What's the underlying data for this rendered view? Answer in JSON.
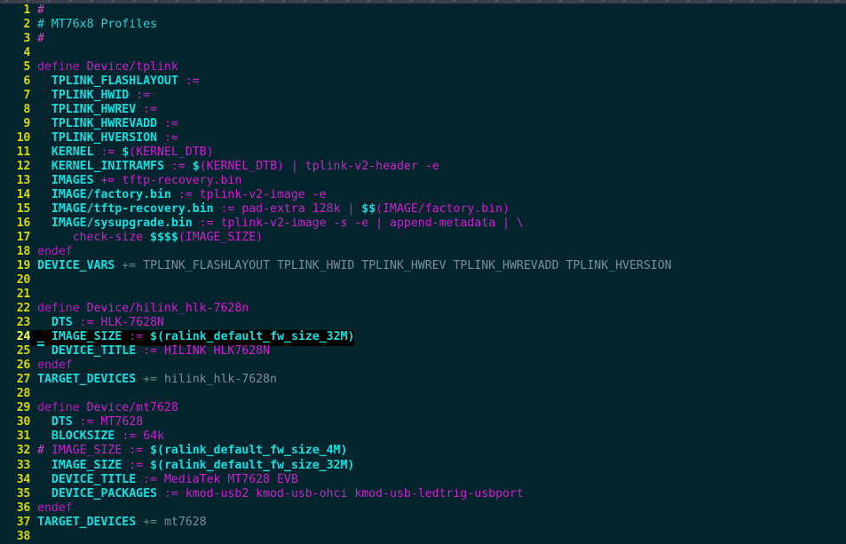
{
  "window": {
    "background_color": "#04242e",
    "topbar_color": "#3a3f4b",
    "title": ""
  },
  "editor": {
    "type": "terminal-text-editor",
    "font": "monospace",
    "line_number_color": "#d9d900",
    "current_line": 24,
    "current_line_bg": "#000000",
    "cursor_glyph": "_",
    "total_lines_visible": 38,
    "colors": {
      "comment": "#1fd6d6",
      "keyword": "#c714c7",
      "variable": "#12e0e0",
      "operator": "#cc21cc",
      "value": "#cc21cc",
      "muted": "#7d8e96",
      "muted_operator": "#5d8f7e"
    },
    "lines": [
      {
        "n": "1",
        "tokens": [
          {
            "t": "#",
            "c": "c-hash"
          }
        ]
      },
      {
        "n": "2",
        "tokens": [
          {
            "t": "# MT76x8 Profiles",
            "c": "c-comment"
          }
        ]
      },
      {
        "n": "3",
        "tokens": [
          {
            "t": "#",
            "c": "c-hash"
          }
        ]
      },
      {
        "n": "4",
        "tokens": []
      },
      {
        "n": "5",
        "tokens": [
          {
            "t": "define",
            "c": "c-keyword"
          },
          {
            "t": " ",
            "c": "c-plain"
          },
          {
            "t": "Device/tplink",
            "c": "c-val"
          }
        ]
      },
      {
        "n": "6",
        "tokens": [
          {
            "t": "  ",
            "c": "c-plain"
          },
          {
            "t": "TPLINK_FLASHLAYOUT",
            "c": "c-var"
          },
          {
            "t": " ",
            "c": "c-plain"
          },
          {
            "t": ":=",
            "c": "c-op"
          }
        ]
      },
      {
        "n": "7",
        "tokens": [
          {
            "t": "  ",
            "c": "c-plain"
          },
          {
            "t": "TPLINK_HWID",
            "c": "c-var"
          },
          {
            "t": " ",
            "c": "c-plain"
          },
          {
            "t": ":=",
            "c": "c-op"
          }
        ]
      },
      {
        "n": "8",
        "tokens": [
          {
            "t": "  ",
            "c": "c-plain"
          },
          {
            "t": "TPLINK_HWREV",
            "c": "c-var"
          },
          {
            "t": " ",
            "c": "c-plain"
          },
          {
            "t": ":=",
            "c": "c-op"
          }
        ]
      },
      {
        "n": "9",
        "tokens": [
          {
            "t": "  ",
            "c": "c-plain"
          },
          {
            "t": "TPLINK_HWREVADD",
            "c": "c-var"
          },
          {
            "t": " ",
            "c": "c-plain"
          },
          {
            "t": ":=",
            "c": "c-op"
          }
        ]
      },
      {
        "n": "10",
        "tokens": [
          {
            "t": "  ",
            "c": "c-plain"
          },
          {
            "t": "TPLINK_HVERSION",
            "c": "c-var"
          },
          {
            "t": " ",
            "c": "c-plain"
          },
          {
            "t": ":=",
            "c": "c-op"
          }
        ]
      },
      {
        "n": "11",
        "tokens": [
          {
            "t": "  ",
            "c": "c-plain"
          },
          {
            "t": "KERNEL",
            "c": "c-var"
          },
          {
            "t": " ",
            "c": "c-plain"
          },
          {
            "t": ":=",
            "c": "c-op"
          },
          {
            "t": " ",
            "c": "c-plain"
          },
          {
            "t": "$",
            "c": "c-dollar"
          },
          {
            "t": "(KERNEL_DTB)",
            "c": "c-val"
          }
        ]
      },
      {
        "n": "12",
        "tokens": [
          {
            "t": "  ",
            "c": "c-plain"
          },
          {
            "t": "KERNEL_INITRAMFS",
            "c": "c-var"
          },
          {
            "t": " ",
            "c": "c-plain"
          },
          {
            "t": ":=",
            "c": "c-op"
          },
          {
            "t": " ",
            "c": "c-plain"
          },
          {
            "t": "$",
            "c": "c-dollar"
          },
          {
            "t": "(KERNEL_DTB) | tplink-v2-header -e",
            "c": "c-val"
          }
        ]
      },
      {
        "n": "13",
        "tokens": [
          {
            "t": "  ",
            "c": "c-plain"
          },
          {
            "t": "IMAGES",
            "c": "c-var"
          },
          {
            "t": " ",
            "c": "c-plain"
          },
          {
            "t": "+=",
            "c": "c-op"
          },
          {
            "t": " tftp-recovery.bin",
            "c": "c-val"
          }
        ]
      },
      {
        "n": "14",
        "tokens": [
          {
            "t": "  ",
            "c": "c-plain"
          },
          {
            "t": "IMAGE/factory.bin",
            "c": "c-var"
          },
          {
            "t": " ",
            "c": "c-plain"
          },
          {
            "t": ":=",
            "c": "c-op"
          },
          {
            "t": " tplink-v2-image -e",
            "c": "c-val"
          }
        ]
      },
      {
        "n": "15",
        "tokens": [
          {
            "t": "  ",
            "c": "c-plain"
          },
          {
            "t": "IMAGE/tftp-recovery.bin",
            "c": "c-var"
          },
          {
            "t": " ",
            "c": "c-plain"
          },
          {
            "t": ":=",
            "c": "c-op"
          },
          {
            "t": " pad-extra 128k | ",
            "c": "c-val"
          },
          {
            "t": "$$",
            "c": "c-dollar"
          },
          {
            "t": "(IMAGE/factory.bin)",
            "c": "c-val"
          }
        ]
      },
      {
        "n": "16",
        "tokens": [
          {
            "t": "  ",
            "c": "c-plain"
          },
          {
            "t": "IMAGE/sysupgrade.bin",
            "c": "c-var"
          },
          {
            "t": " ",
            "c": "c-plain"
          },
          {
            "t": ":=",
            "c": "c-op"
          },
          {
            "t": " tplink-v2-image -s -e | append-metadata | \\",
            "c": "c-val"
          }
        ]
      },
      {
        "n": "17",
        "tokens": [
          {
            "t": "     ",
            "c": "c-plain"
          },
          {
            "t": "check-size ",
            "c": "c-val"
          },
          {
            "t": "$$$$",
            "c": "c-dollar"
          },
          {
            "t": "(IMAGE_SIZE)",
            "c": "c-val"
          }
        ]
      },
      {
        "n": "18",
        "tokens": [
          {
            "t": "endef",
            "c": "c-keyword"
          }
        ]
      },
      {
        "n": "19",
        "tokens": [
          {
            "t": "DEVICE_VARS",
            "c": "c-var"
          },
          {
            "t": " ",
            "c": "c-plain"
          },
          {
            "t": "+=",
            "c": "c-grayop"
          },
          {
            "t": " TPLINK_FLASHLAYOUT TPLINK_HWID TPLINK_HWREV TPLINK_HWREVADD TPLINK_HVERSION",
            "c": "c-gray"
          }
        ]
      },
      {
        "n": "20",
        "tokens": []
      },
      {
        "n": "21",
        "tokens": []
      },
      {
        "n": "22",
        "tokens": [
          {
            "t": "define",
            "c": "c-keyword"
          },
          {
            "t": " ",
            "c": "c-plain"
          },
          {
            "t": "Device/hilink_hlk-7628n",
            "c": "c-val"
          }
        ]
      },
      {
        "n": "23",
        "tokens": [
          {
            "t": "  ",
            "c": "c-plain"
          },
          {
            "t": "DTS",
            "c": "c-var"
          },
          {
            "t": " ",
            "c": "c-plain"
          },
          {
            "t": ":=",
            "c": "c-op"
          },
          {
            "t": " HLK-7628N",
            "c": "c-val"
          }
        ]
      },
      {
        "n": "24",
        "current": true,
        "cursor": "_",
        "tokens": [
          {
            "t": " ",
            "c": "c-plain"
          },
          {
            "t": "IMAGE_SIZE",
            "c": "c-var"
          },
          {
            "t": " ",
            "c": "c-plain"
          },
          {
            "t": ":=",
            "c": "c-op"
          },
          {
            "t": " ",
            "c": "c-plain"
          },
          {
            "t": "$",
            "c": "c-dollar"
          },
          {
            "t": "(ralink_default_fw_size_32M)",
            "c": "c-var"
          }
        ]
      },
      {
        "n": "25",
        "tokens": [
          {
            "t": "  ",
            "c": "c-plain"
          },
          {
            "t": "DEVICE_TITLE",
            "c": "c-var"
          },
          {
            "t": " ",
            "c": "c-plain"
          },
          {
            "t": ":=",
            "c": "c-op"
          },
          {
            "t": " HILINK HLK7628N",
            "c": "c-val"
          }
        ]
      },
      {
        "n": "26",
        "tokens": [
          {
            "t": "endef",
            "c": "c-keyword"
          }
        ]
      },
      {
        "n": "27",
        "tokens": [
          {
            "t": "TARGET_DEVICES",
            "c": "c-var"
          },
          {
            "t": " ",
            "c": "c-plain"
          },
          {
            "t": "+=",
            "c": "c-grayop"
          },
          {
            "t": " hilink_hlk-7628n",
            "c": "c-gray"
          }
        ]
      },
      {
        "n": "28",
        "tokens": []
      },
      {
        "n": "29",
        "tokens": [
          {
            "t": "define",
            "c": "c-keyword"
          },
          {
            "t": " ",
            "c": "c-plain"
          },
          {
            "t": "Device/mt7628",
            "c": "c-val"
          }
        ]
      },
      {
        "n": "30",
        "tokens": [
          {
            "t": "  ",
            "c": "c-plain"
          },
          {
            "t": "DTS",
            "c": "c-var"
          },
          {
            "t": " ",
            "c": "c-plain"
          },
          {
            "t": ":=",
            "c": "c-op"
          },
          {
            "t": " MT7628",
            "c": "c-val"
          }
        ]
      },
      {
        "n": "31",
        "tokens": [
          {
            "t": "  ",
            "c": "c-plain"
          },
          {
            "t": "BLOCKSIZE",
            "c": "c-var"
          },
          {
            "t": " ",
            "c": "c-plain"
          },
          {
            "t": ":=",
            "c": "c-op"
          },
          {
            "t": " 64k",
            "c": "c-val"
          }
        ]
      },
      {
        "n": "32",
        "tokens": [
          {
            "t": "#",
            "c": "c-hash"
          },
          {
            "t": " IMAGE_SIZE ",
            "c": "c-val"
          },
          {
            "t": ":=",
            "c": "c-op"
          },
          {
            "t": " ",
            "c": "c-plain"
          },
          {
            "t": "$",
            "c": "c-dollar"
          },
          {
            "t": "(ralink_default_fw_size_4M)",
            "c": "c-var"
          }
        ]
      },
      {
        "n": "33",
        "tokens": [
          {
            "t": "  ",
            "c": "c-plain"
          },
          {
            "t": "IMAGE_SIZE",
            "c": "c-var"
          },
          {
            "t": " ",
            "c": "c-plain"
          },
          {
            "t": ":=",
            "c": "c-op"
          },
          {
            "t": " ",
            "c": "c-plain"
          },
          {
            "t": "$",
            "c": "c-dollar"
          },
          {
            "t": "(ralink_default_fw_size_32M)",
            "c": "c-var"
          }
        ]
      },
      {
        "n": "34",
        "tokens": [
          {
            "t": "  ",
            "c": "c-plain"
          },
          {
            "t": "DEVICE_TITLE",
            "c": "c-var"
          },
          {
            "t": " ",
            "c": "c-plain"
          },
          {
            "t": ":=",
            "c": "c-op"
          },
          {
            "t": " MediaTek MT7628 EVB",
            "c": "c-val"
          }
        ]
      },
      {
        "n": "35",
        "tokens": [
          {
            "t": "  ",
            "c": "c-plain"
          },
          {
            "t": "DEVICE_PACKAGES",
            "c": "c-var"
          },
          {
            "t": " ",
            "c": "c-plain"
          },
          {
            "t": ":=",
            "c": "c-op"
          },
          {
            "t": " kmod-usb2 kmod-usb-ohci kmod-usb-ledtrig-usbport",
            "c": "c-val"
          }
        ]
      },
      {
        "n": "36",
        "tokens": [
          {
            "t": "endef",
            "c": "c-keyword"
          }
        ]
      },
      {
        "n": "37",
        "tokens": [
          {
            "t": "TARGET_DEVICES",
            "c": "c-var"
          },
          {
            "t": " ",
            "c": "c-plain"
          },
          {
            "t": "+=",
            "c": "c-grayop"
          },
          {
            "t": " mt7628",
            "c": "c-gray"
          }
        ]
      },
      {
        "n": "38",
        "tokens": []
      }
    ]
  }
}
